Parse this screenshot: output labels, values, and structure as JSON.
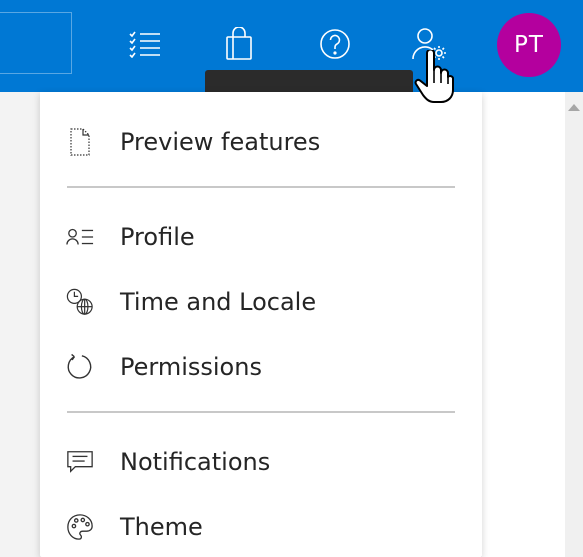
{
  "header": {
    "avatar_initials": "PT",
    "brand_color": "#0078d4",
    "avatar_color": "#b4009e",
    "icons": [
      "tasks-icon",
      "store-bag-icon",
      "help-icon",
      "account-settings-icon"
    ]
  },
  "menu": {
    "items": [
      {
        "label": "Preview features",
        "icon": "document-outline-icon"
      },
      {
        "label": "Profile",
        "icon": "profile-list-icon"
      },
      {
        "label": "Time and Locale",
        "icon": "clock-globe-icon"
      },
      {
        "label": "Permissions",
        "icon": "refresh-circle-icon"
      },
      {
        "label": "Notifications",
        "icon": "chat-bubble-icon"
      },
      {
        "label": "Theme",
        "icon": "palette-icon"
      }
    ]
  }
}
